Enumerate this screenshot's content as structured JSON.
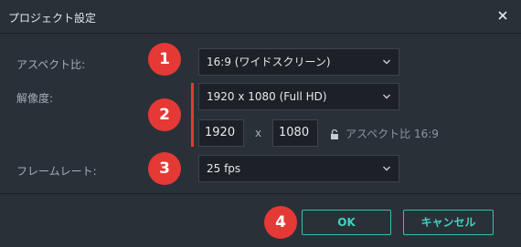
{
  "window": {
    "title": "プロジェクト設定",
    "close_icon": "close-icon"
  },
  "form": {
    "aspect_label": "アスペクト比:",
    "aspect_value": "16:9 (ワイドスクリーン)",
    "resolution_label": "解像度:",
    "resolution_value": "1920 x 1080 (Full HD)",
    "width_value": "1920",
    "times": "x",
    "height_value": "1080",
    "lock_icon": "lock-icon",
    "aspect_lock_text": "アスペクト比 16:9",
    "framerate_label": "フレームレート:",
    "framerate_value": "25 fps"
  },
  "badges": [
    "1",
    "2",
    "3",
    "4"
  ],
  "footer": {
    "ok_label": "OK",
    "cancel_label": "キャンセル"
  },
  "colors": {
    "badge": "#e53935",
    "accent": "#36c0b0",
    "background": "#2a3038"
  }
}
